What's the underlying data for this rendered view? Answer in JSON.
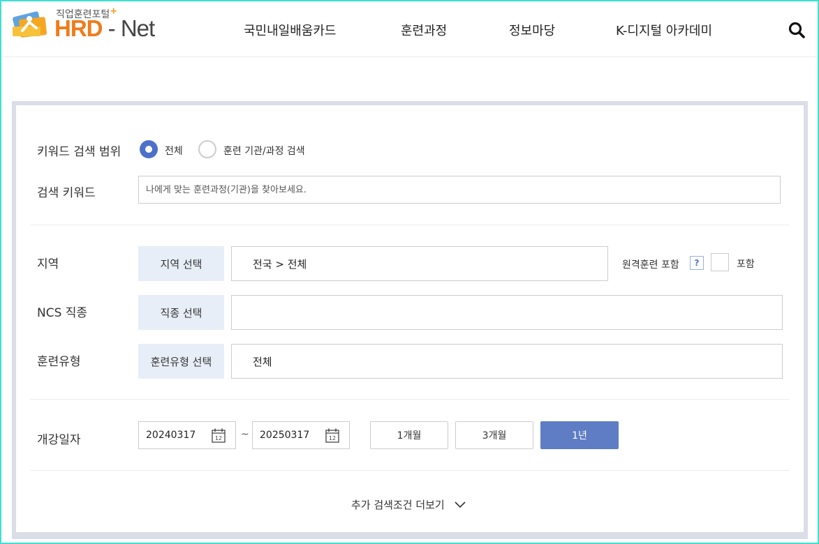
{
  "header": {
    "logo": {
      "tagline": "직업훈련포털",
      "plus": "+",
      "brand_main": "HRD",
      "brand_sep": "-",
      "brand_sub": "Net"
    },
    "nav": [
      {
        "label": "국민내일배움카드"
      },
      {
        "label": "훈련과정"
      },
      {
        "label": "정보마당"
      },
      {
        "label": "K-디지털 아카데미"
      }
    ],
    "search_icon": "search-icon"
  },
  "search": {
    "scope_label": "키워드 검색 범위",
    "scope_options": [
      {
        "label": "전체",
        "selected": true
      },
      {
        "label": "훈련 기관/과정 검색",
        "selected": false
      }
    ],
    "keyword_label": "검색 키워드",
    "keyword_placeholder": "나에게 맞는 훈련과정(기관)을 찾아보세요.",
    "keyword_value": ""
  },
  "filters": {
    "region": {
      "label": "지역",
      "button": "지역 선택",
      "value": "전국 > 전체"
    },
    "remote": {
      "label": "원격훈련 포함",
      "help": "?",
      "checkbox_label": "포함",
      "checked": false
    },
    "ncs": {
      "label": "NCS 직종",
      "button": "직종 선택",
      "value": ""
    },
    "training_type": {
      "label": "훈련유형",
      "button": "훈련유형 선택",
      "value": "전체"
    }
  },
  "dates": {
    "label": "개강일자",
    "start": "20240317",
    "end": "20250317",
    "separator": "~",
    "calendar_day": "12",
    "periods": [
      {
        "label": "1개월",
        "active": false
      },
      {
        "label": "3개월",
        "active": false
      },
      {
        "label": "1년",
        "active": true
      }
    ]
  },
  "more_label": "추가 검색조건 더보기",
  "colors": {
    "accent": "#4d71c8",
    "active_button": "#5f7dc4",
    "select_bg": "#e8eef8",
    "logo_orange": "#f07b1a",
    "frame": "#3fe0d0"
  }
}
